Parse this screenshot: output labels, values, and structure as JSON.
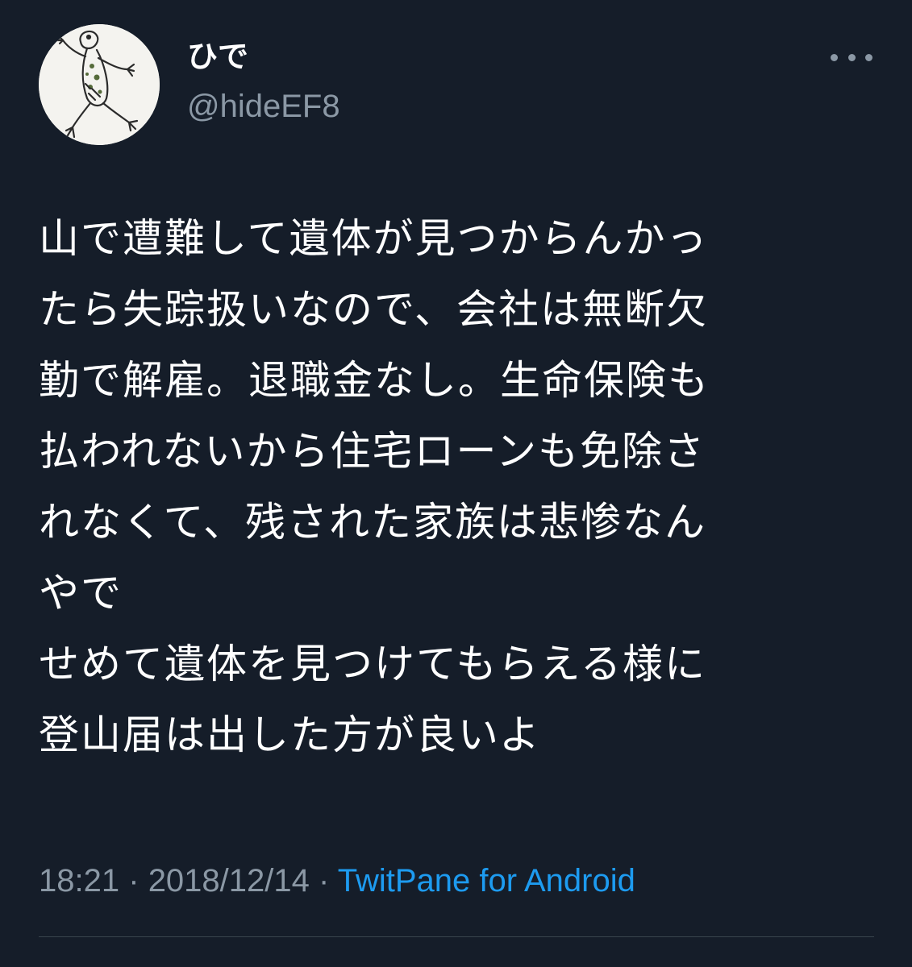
{
  "tweet": {
    "display_name": "ひで",
    "handle": "@hideEF8",
    "text": "山で遭難して遺体が見つからんかっ\nたら失踪扱いなので、会社は無断欠\n勤で解雇。退職金なし。生命保険も\n払われないから住宅ローンも免除さ\nれなくて、残された家族は悲惨なん\nやで\nせめて遺体を見つけてもらえる様に\n登山届は出した方が良いよ",
    "time": "18:21",
    "separator": "·",
    "date": "2018/12/14",
    "source": "TwitPane for Android"
  },
  "icons": {
    "avatar": "frog-sketch-avatar",
    "more": "more-horizontal-icon"
  },
  "colors": {
    "background": "#151d29",
    "text": "#ffffff",
    "secondary": "#8b98a5",
    "link": "#1d9bf0",
    "divider": "#38444d"
  }
}
